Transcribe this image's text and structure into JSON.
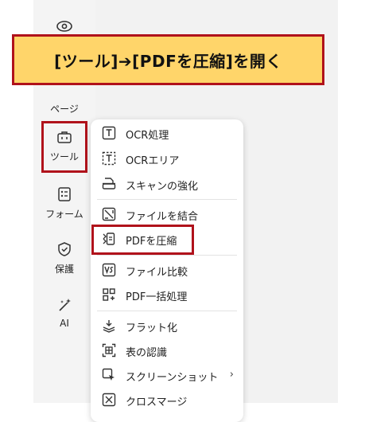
{
  "banner": {
    "text": "[ツール]➔[PDFを圧縮]を開く"
  },
  "rail": {
    "items": [
      {
        "label": "ページ",
        "icon": "pages-icon"
      },
      {
        "label": "ツール",
        "icon": "toolbox-icon"
      },
      {
        "label": "フォーム",
        "icon": "form-icon"
      },
      {
        "label": "保護",
        "icon": "shield-icon"
      },
      {
        "label": "AI",
        "icon": "ai-wand-icon"
      }
    ]
  },
  "menu": {
    "items": [
      {
        "label": "OCR処理",
        "icon": "ocr-icon"
      },
      {
        "label": "OCRエリア",
        "icon": "ocr-area-icon"
      },
      {
        "label": "スキャンの強化",
        "icon": "scan-enhance-icon"
      },
      {
        "label": "ファイルを結合",
        "icon": "combine-files-icon"
      },
      {
        "label": "PDFを圧縮",
        "icon": "compress-pdf-icon"
      },
      {
        "label": "ファイル比較",
        "icon": "compare-files-icon"
      },
      {
        "label": "PDF一括処理",
        "icon": "batch-process-icon"
      },
      {
        "label": "フラット化",
        "icon": "flatten-icon"
      },
      {
        "label": "表の認識",
        "icon": "table-recognition-icon"
      },
      {
        "label": "スクリーンショット",
        "icon": "screenshot-icon",
        "chevron": "›"
      },
      {
        "label": "クロスマージ",
        "icon": "cross-merge-icon"
      }
    ]
  },
  "colors": {
    "highlight_border": "#b0121b",
    "banner_bg": "#ffd56a"
  }
}
